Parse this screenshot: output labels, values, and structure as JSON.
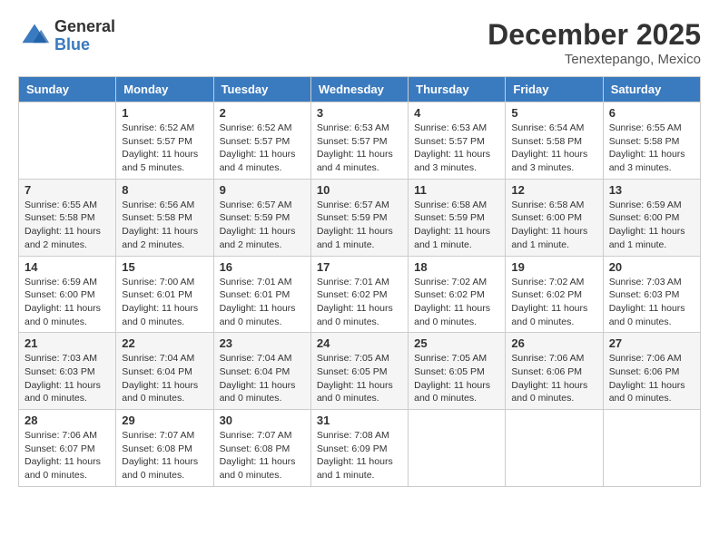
{
  "header": {
    "logo": {
      "general": "General",
      "blue": "Blue"
    },
    "title": "December 2025",
    "location": "Tenextepango, Mexico"
  },
  "days_of_week": [
    "Sunday",
    "Monday",
    "Tuesday",
    "Wednesday",
    "Thursday",
    "Friday",
    "Saturday"
  ],
  "weeks": [
    [
      {
        "day": "",
        "info": ""
      },
      {
        "day": "1",
        "info": "Sunrise: 6:52 AM\nSunset: 5:57 PM\nDaylight: 11 hours\nand 5 minutes."
      },
      {
        "day": "2",
        "info": "Sunrise: 6:52 AM\nSunset: 5:57 PM\nDaylight: 11 hours\nand 4 minutes."
      },
      {
        "day": "3",
        "info": "Sunrise: 6:53 AM\nSunset: 5:57 PM\nDaylight: 11 hours\nand 4 minutes."
      },
      {
        "day": "4",
        "info": "Sunrise: 6:53 AM\nSunset: 5:57 PM\nDaylight: 11 hours\nand 3 minutes."
      },
      {
        "day": "5",
        "info": "Sunrise: 6:54 AM\nSunset: 5:58 PM\nDaylight: 11 hours\nand 3 minutes."
      },
      {
        "day": "6",
        "info": "Sunrise: 6:55 AM\nSunset: 5:58 PM\nDaylight: 11 hours\nand 3 minutes."
      }
    ],
    [
      {
        "day": "7",
        "info": "Sunrise: 6:55 AM\nSunset: 5:58 PM\nDaylight: 11 hours\nand 2 minutes."
      },
      {
        "day": "8",
        "info": "Sunrise: 6:56 AM\nSunset: 5:58 PM\nDaylight: 11 hours\nand 2 minutes."
      },
      {
        "day": "9",
        "info": "Sunrise: 6:57 AM\nSunset: 5:59 PM\nDaylight: 11 hours\nand 2 minutes."
      },
      {
        "day": "10",
        "info": "Sunrise: 6:57 AM\nSunset: 5:59 PM\nDaylight: 11 hours\nand 1 minute."
      },
      {
        "day": "11",
        "info": "Sunrise: 6:58 AM\nSunset: 5:59 PM\nDaylight: 11 hours\nand 1 minute."
      },
      {
        "day": "12",
        "info": "Sunrise: 6:58 AM\nSunset: 6:00 PM\nDaylight: 11 hours\nand 1 minute."
      },
      {
        "day": "13",
        "info": "Sunrise: 6:59 AM\nSunset: 6:00 PM\nDaylight: 11 hours\nand 1 minute."
      }
    ],
    [
      {
        "day": "14",
        "info": "Sunrise: 6:59 AM\nSunset: 6:00 PM\nDaylight: 11 hours\nand 0 minutes."
      },
      {
        "day": "15",
        "info": "Sunrise: 7:00 AM\nSunset: 6:01 PM\nDaylight: 11 hours\nand 0 minutes."
      },
      {
        "day": "16",
        "info": "Sunrise: 7:01 AM\nSunset: 6:01 PM\nDaylight: 11 hours\nand 0 minutes."
      },
      {
        "day": "17",
        "info": "Sunrise: 7:01 AM\nSunset: 6:02 PM\nDaylight: 11 hours\nand 0 minutes."
      },
      {
        "day": "18",
        "info": "Sunrise: 7:02 AM\nSunset: 6:02 PM\nDaylight: 11 hours\nand 0 minutes."
      },
      {
        "day": "19",
        "info": "Sunrise: 7:02 AM\nSunset: 6:02 PM\nDaylight: 11 hours\nand 0 minutes."
      },
      {
        "day": "20",
        "info": "Sunrise: 7:03 AM\nSunset: 6:03 PM\nDaylight: 11 hours\nand 0 minutes."
      }
    ],
    [
      {
        "day": "21",
        "info": "Sunrise: 7:03 AM\nSunset: 6:03 PM\nDaylight: 11 hours\nand 0 minutes."
      },
      {
        "day": "22",
        "info": "Sunrise: 7:04 AM\nSunset: 6:04 PM\nDaylight: 11 hours\nand 0 minutes."
      },
      {
        "day": "23",
        "info": "Sunrise: 7:04 AM\nSunset: 6:04 PM\nDaylight: 11 hours\nand 0 minutes."
      },
      {
        "day": "24",
        "info": "Sunrise: 7:05 AM\nSunset: 6:05 PM\nDaylight: 11 hours\nand 0 minutes."
      },
      {
        "day": "25",
        "info": "Sunrise: 7:05 AM\nSunset: 6:05 PM\nDaylight: 11 hours\nand 0 minutes."
      },
      {
        "day": "26",
        "info": "Sunrise: 7:06 AM\nSunset: 6:06 PM\nDaylight: 11 hours\nand 0 minutes."
      },
      {
        "day": "27",
        "info": "Sunrise: 7:06 AM\nSunset: 6:06 PM\nDaylight: 11 hours\nand 0 minutes."
      }
    ],
    [
      {
        "day": "28",
        "info": "Sunrise: 7:06 AM\nSunset: 6:07 PM\nDaylight: 11 hours\nand 0 minutes."
      },
      {
        "day": "29",
        "info": "Sunrise: 7:07 AM\nSunset: 6:08 PM\nDaylight: 11 hours\nand 0 minutes."
      },
      {
        "day": "30",
        "info": "Sunrise: 7:07 AM\nSunset: 6:08 PM\nDaylight: 11 hours\nand 0 minutes."
      },
      {
        "day": "31",
        "info": "Sunrise: 7:08 AM\nSunset: 6:09 PM\nDaylight: 11 hours\nand 1 minute."
      },
      {
        "day": "",
        "info": ""
      },
      {
        "day": "",
        "info": ""
      },
      {
        "day": "",
        "info": ""
      }
    ]
  ]
}
